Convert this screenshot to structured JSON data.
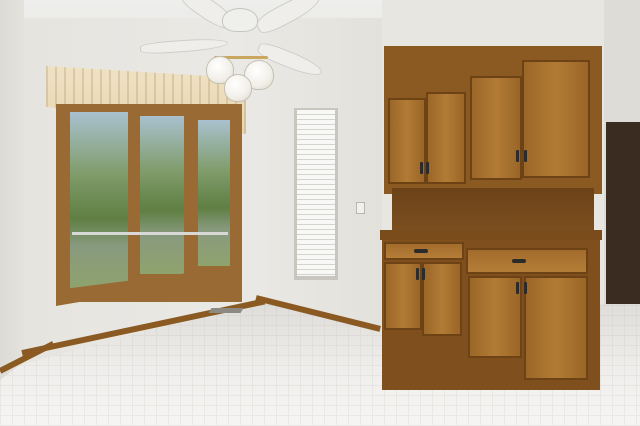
{
  "scene": {
    "kind": "photo",
    "colors": {
      "wall": "#e8e6e1",
      "cabinet_wood": "#a36c2c",
      "trim": "#8a5a22",
      "floor": "#efeeec"
    },
    "icons": [
      "ceiling-fan-icon",
      "light-globe-icon",
      "cabinet-handle-icon"
    ]
  }
}
